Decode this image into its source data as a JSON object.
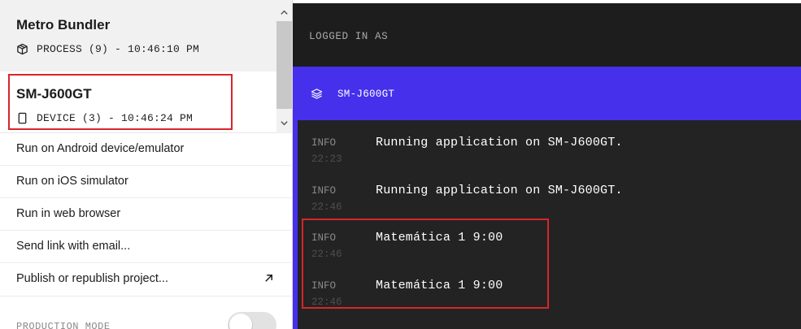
{
  "sidebar": {
    "process": {
      "title": "Metro Bundler",
      "subtitle": "PROCESS (9) - 10:46:10 PM",
      "icon": "package-icon"
    },
    "device": {
      "title": "SM-J600GT",
      "subtitle": "DEVICE (3) - 10:46:24 PM",
      "icon": "phone-icon"
    },
    "menu": [
      {
        "label": "Run on Android device/emulator"
      },
      {
        "label": "Run on iOS simulator"
      },
      {
        "label": "Run in web browser"
      },
      {
        "label": "Send link with email..."
      },
      {
        "label": "Publish or republish project...",
        "icon": "external-link-icon"
      }
    ],
    "production_mode": {
      "label": "PRODUCTION MODE"
    }
  },
  "log_panel": {
    "logged_in_as": "LOGGED IN AS",
    "device_name": "SM-J600GT",
    "entries": [
      {
        "level": "INFO",
        "time": "22:23",
        "message": "Running application on SM-J600GT."
      },
      {
        "level": "INFO",
        "time": "22:46",
        "message": "Running application on SM-J600GT."
      },
      {
        "level": "INFO",
        "time": "22:46",
        "message": "Matemática 1 9:00"
      },
      {
        "level": "INFO",
        "time": "22:46",
        "message": "Matemática 1 9:00"
      }
    ]
  },
  "colors": {
    "accent": "#4630eb",
    "highlight": "#d7262b",
    "log_background": "#232323"
  }
}
